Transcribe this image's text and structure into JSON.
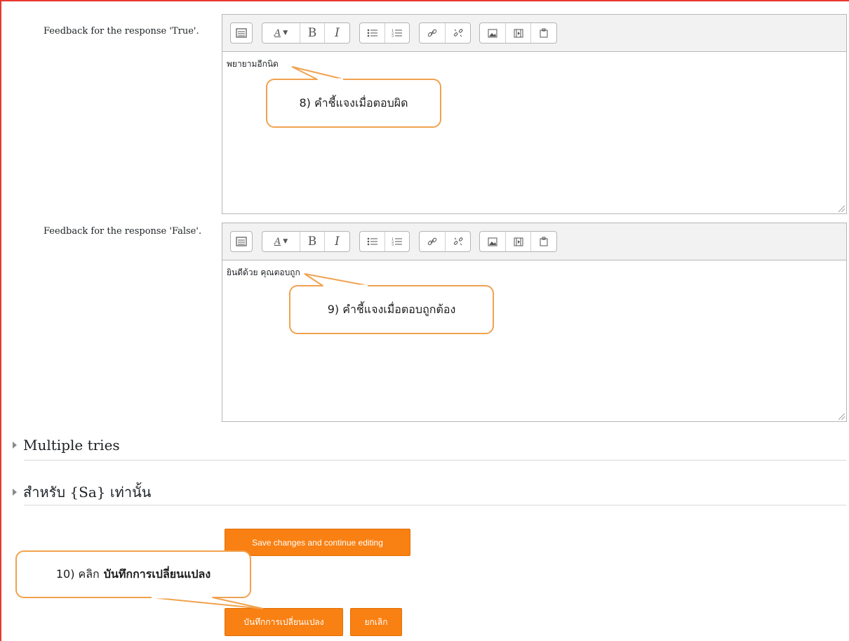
{
  "feedback_true": {
    "label": "Feedback for the response 'True'.",
    "content": "พยายามอีกนิด"
  },
  "feedback_false": {
    "label": "Feedback for the response 'False'.",
    "content": "ยินดีด้วย คุณตอบถูก"
  },
  "toolbar": {
    "text_size_glyph": "A",
    "bold": "B",
    "italic": "I",
    "icons": [
      "show-more-buttons-icon",
      "paragraph-styles-icon",
      "bold-icon",
      "italic-icon",
      "unordered-list-icon",
      "ordered-list-icon",
      "link-icon",
      "unlink-icon",
      "insert-image-icon",
      "insert-media-icon",
      "manage-files-icon"
    ]
  },
  "sections": {
    "multiple_tries": "Multiple tries",
    "for_sa_only": "สำหรับ {Sa} เท่านั้น"
  },
  "buttons": {
    "save_continue": "Save changes and continue editing",
    "save": "บันทึกการเปลี่ยนแปลง",
    "cancel": "ยกเลิก"
  },
  "callouts": {
    "c8": "8)  คำชี้แจงเมื่อตอบผิด",
    "c9": "9)  คำชี้แจงเมื่อตอบถูกต้อง",
    "c10_prefix": "10) คลิก",
    "c10_bold": "บันทึกการเปลี่ยนแปลง"
  },
  "colors": {
    "accent_orange": "#f98012",
    "callout_border": "#f0a24f",
    "frame_red": "#e8382f"
  }
}
